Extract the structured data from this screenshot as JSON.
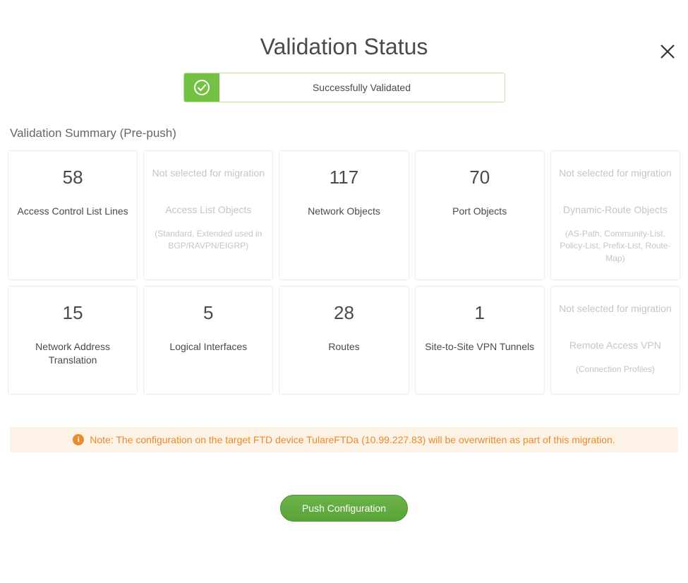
{
  "title": "Validation Status",
  "status_label": "Successfully Validated",
  "summary_heading": "Validation Summary (Pre-push)",
  "not_selected_text": "Not selected for migration",
  "cards_row1": [
    {
      "value": "58",
      "label": "Access Control List Lines",
      "disabled": false,
      "sublabel": ""
    },
    {
      "value": "_NS",
      "label": "Access List Objects",
      "disabled": true,
      "sublabel": "(Standard, Extended used in BGP/RAVPN/EIGRP)"
    },
    {
      "value": "117",
      "label": "Network Objects",
      "disabled": false,
      "sublabel": ""
    },
    {
      "value": "70",
      "label": "Port Objects",
      "disabled": false,
      "sublabel": ""
    },
    {
      "value": "_NS",
      "label": "Dynamic-Route Objects",
      "disabled": true,
      "sublabel": "(AS-Path, Community-List, Policy-List, Prefix-List, Route-Map)"
    }
  ],
  "cards_row2": [
    {
      "value": "15",
      "label": "Network Address Translation",
      "disabled": false,
      "sublabel": ""
    },
    {
      "value": "5",
      "label": "Logical Interfaces",
      "disabled": false,
      "sublabel": ""
    },
    {
      "value": "28",
      "label": "Routes",
      "disabled": false,
      "sublabel": ""
    },
    {
      "value": "1",
      "label": "Site-to-Site VPN Tunnels",
      "disabled": false,
      "sublabel": ""
    },
    {
      "value": "_NS",
      "label": "Remote Access VPN",
      "disabled": true,
      "sublabel": "(Connection Profiles)"
    }
  ],
  "note_text": "Note: The configuration on the target FTD device TulareFTDa (10.99.227.83) will be overwritten as part of this migration.",
  "push_button_label": "Push Configuration"
}
